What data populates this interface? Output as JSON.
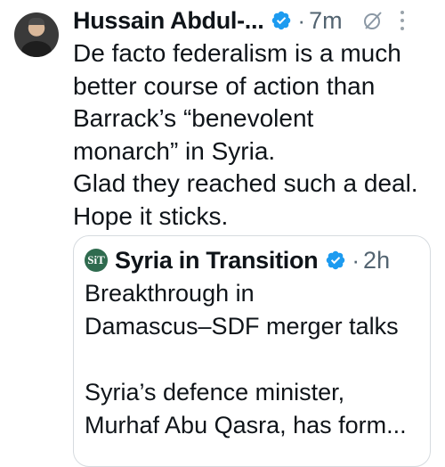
{
  "tweet": {
    "author_name": "Hussain Abdul-...",
    "time": "7m",
    "separator": "·",
    "text": "De facto federalism is a much\nbetter course of action than\nBarrack’s “benevolent\nmonarch” in Syria.\nGlad they reached such a deal.\nHope it sticks."
  },
  "quote": {
    "avatar_text": "SiT",
    "author_name": "Syria in Transition",
    "time": "2h",
    "separator": "·",
    "text": "Breakthrough in\nDamascus–SDF merger talks\n\nSyria’s defence minister,\nMurhaf Abu Qasra, has form..."
  },
  "icons": {
    "verified": "verified-badge-icon",
    "grok": "grok-icon",
    "more": "more-icon"
  },
  "colors": {
    "verified_blue": "#1d9bf0",
    "secondary_text": "#536471",
    "border": "#d6dbdf"
  }
}
